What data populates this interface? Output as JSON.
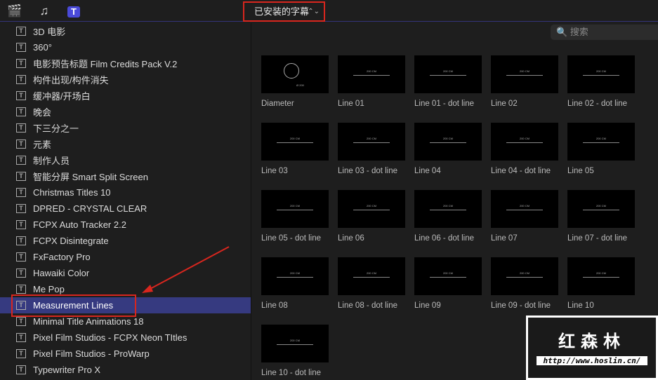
{
  "toolbar": {
    "icons": [
      "clapper-star-icon",
      "music-photo-icon",
      "titles-icon"
    ],
    "dropdown_label": "已安装的字幕",
    "search_placeholder": "搜索"
  },
  "sidebar": {
    "items": [
      "3D 电影",
      "360°",
      "电影预告标题 Film Credits Pack V.2",
      "构件出现/构件消失",
      "缓冲器/开场白",
      "晚会",
      "下三分之一",
      "元素",
      "制作人员",
      "智能分屏 Smart Split Screen",
      "Christmas Titles 10",
      "DPRED - CRYSTAL CLEAR",
      "FCPX Auto Tracker 2.2",
      "FCPX Disintegrate",
      "FxFactory Pro",
      "Hawaiki Color",
      "Me Pop",
      "Measurement Lines",
      "Minimal Title Animations 18",
      "Pixel Film Studios - FCPX Neon TItles",
      "Pixel Film Studios - ProWarp",
      "Typewriter Pro X"
    ],
    "selected_index": 17
  },
  "thumb_text": "200 CM",
  "diameter_text": "Ø 200",
  "titles": [
    "Diameter",
    "Line 01",
    "Line 01 - dot line",
    "Line 02",
    "Line 02 - dot line",
    "Line 03",
    "Line 03 - dot line",
    "Line 04",
    "Line 04 - dot line",
    "Line 05",
    "Line 05 - dot line",
    "Line 06",
    "Line 06 - dot line",
    "Line 07",
    "Line 07 - dot line",
    "Line 08",
    "Line 08 - dot line",
    "Line 09",
    "Line 09 - dot line",
    "Line 10",
    "Line 10 - dot line"
  ],
  "watermark": {
    "title": "红森林",
    "url": "http://www.hoslin.cn/"
  }
}
